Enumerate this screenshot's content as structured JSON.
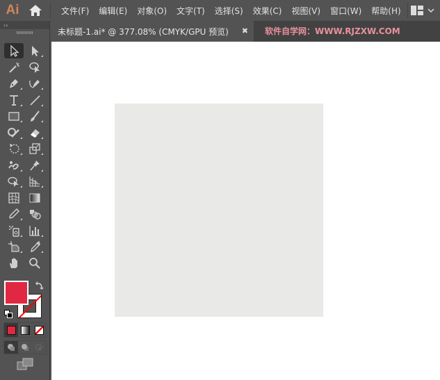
{
  "app": {
    "logo": "Ai",
    "home_icon": "home-icon",
    "menu": [
      "文件(F)",
      "编辑(E)",
      "对象(O)",
      "文字(T)",
      "选择(S)",
      "效果(C)",
      "视图(V)",
      "窗口(W)",
      "帮助(H)"
    ],
    "workspace_switcher_icon": "workspace-layout-icon"
  },
  "document": {
    "tab_title": "未标题-1.ai* @ 377.08% (CMYK/GPU 预览)",
    "close_label": "✖",
    "watermark": "软件自学网：WWW.RJZXW.COM"
  },
  "toolbar": {
    "collapse_label": "‹‹",
    "tools": [
      {
        "name": "selection-tool",
        "selected": true
      },
      {
        "name": "direct-selection-tool"
      },
      {
        "name": "magic-wand-tool"
      },
      {
        "name": "lasso-tool"
      },
      {
        "name": "pen-tool"
      },
      {
        "name": "curvature-tool"
      },
      {
        "name": "type-tool"
      },
      {
        "name": "line-segment-tool"
      },
      {
        "name": "rectangle-tool"
      },
      {
        "name": "paintbrush-tool"
      },
      {
        "name": "shaper-tool"
      },
      {
        "name": "eraser-tool"
      },
      {
        "name": "rotate-tool"
      },
      {
        "name": "scale-tool"
      },
      {
        "name": "puppet-warp-tool"
      },
      {
        "name": "free-transform-pin-tool"
      },
      {
        "name": "shape-builder-tool"
      },
      {
        "name": "perspective-grid-tool"
      },
      {
        "name": "mesh-tool"
      },
      {
        "name": "gradient-tool"
      },
      {
        "name": "eyedropper-tool"
      },
      {
        "name": "blend-tool"
      },
      {
        "name": "symbol-sprayer-tool"
      },
      {
        "name": "column-graph-tool"
      },
      {
        "name": "artboard-tool"
      },
      {
        "name": "slice-tool"
      },
      {
        "name": "hand-tool"
      },
      {
        "name": "zoom-tool"
      }
    ]
  },
  "colors": {
    "fill": "#e12843",
    "stroke": "none",
    "canvas_shape_fill": "#e9e9e7",
    "watermark_color": "#e8909e",
    "logo_color": "#d3865b"
  },
  "color_modes": [
    "color",
    "gradient",
    "none"
  ],
  "draw_modes": [
    "draw-normal",
    "draw-behind",
    "draw-inside"
  ]
}
